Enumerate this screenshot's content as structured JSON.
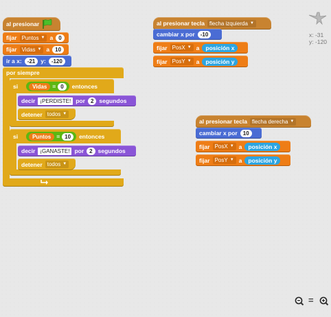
{
  "script1": {
    "when_flag": "al presionar",
    "set_points": {
      "label": "fijar",
      "var": "Puntos",
      "to": "a",
      "value": "0"
    },
    "set_lives": {
      "label": "fijar",
      "var": "Vidas",
      "to": "a",
      "value": "10"
    },
    "goto": {
      "label": "ir a x:",
      "x": "-21",
      "ylabel": "y:",
      "y": "-120"
    },
    "forever": "por siempre",
    "if1": {
      "label": "si",
      "var": "Vidas",
      "op": "=",
      "value": "0",
      "then": "entonces"
    },
    "say1": {
      "label": "decir",
      "text": "¡PERDISTE!",
      "for": "por",
      "secs": "2",
      "unit": "segundos"
    },
    "stop1": {
      "label": "detener",
      "option": "todos"
    },
    "if2": {
      "label": "si",
      "var": "Puntos",
      "op": "=",
      "value": "10",
      "then": "entonces"
    },
    "say2": {
      "label": "decir",
      "text": "¡GANASTE!",
      "for": "por",
      "secs": "2",
      "unit": "segundos"
    },
    "stop2": {
      "label": "detener",
      "option": "todos"
    }
  },
  "script2": {
    "hat": {
      "label": "al presionar tecla",
      "key": "flecha izquierda"
    },
    "change": {
      "label": "cambiar x por",
      "value": "-10"
    },
    "setx": {
      "label": "fijar",
      "var": "PosX",
      "to": "a",
      "reporter": "posición x"
    },
    "sety": {
      "label": "fijar",
      "var": "PosY",
      "to": "a",
      "reporter": "posición y"
    }
  },
  "script3": {
    "hat": {
      "label": "al presionar tecla",
      "key": "flecha derecha"
    },
    "change": {
      "label": "cambiar x por",
      "value": "10"
    },
    "setx": {
      "label": "fijar",
      "var": "PosX",
      "to": "a",
      "reporter": "posición x"
    },
    "sety": {
      "label": "fijar",
      "var": "PosY",
      "to": "a",
      "reporter": "posición y"
    }
  },
  "sprite_info": {
    "x": "x: -31",
    "y": "y: -120"
  },
  "zoom": {
    "out": "−",
    "reset": "=",
    "in": "+"
  },
  "colors": {
    "events": "#c88330",
    "data": "#ee7d16",
    "motion": "#4a6cd4",
    "looks": "#8a55d7",
    "control": "#e1a91a",
    "operators": "#5cb712",
    "sensing": "#2ca5e2"
  },
  "icons": {
    "flag": "green-flag-icon",
    "sprite": "sprite-thumbnail-icon",
    "zoom_out": "zoom-out-icon",
    "zoom_reset": "zoom-reset-icon",
    "zoom_in": "zoom-in-icon"
  }
}
